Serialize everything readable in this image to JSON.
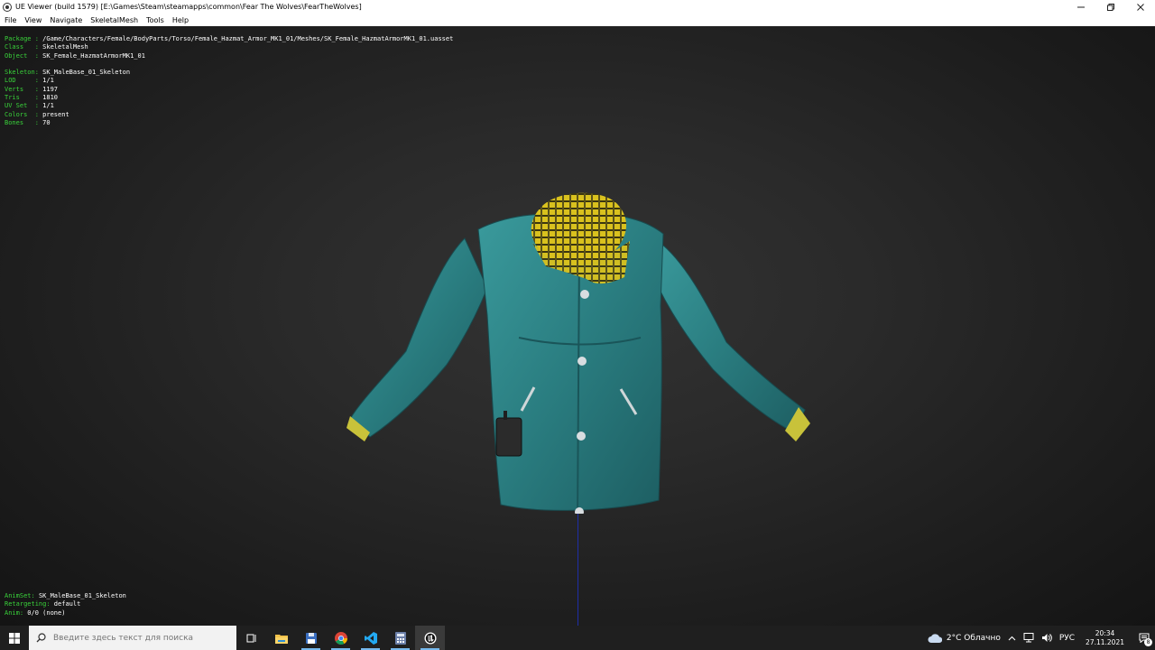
{
  "window": {
    "title": "UE Viewer (build 1579) [E:\\Games\\Steam\\steamapps\\common\\Fear The Wolves\\FearTheWolves]",
    "controls": [
      "minimize-icon",
      "restore-icon",
      "close-icon"
    ]
  },
  "menu": [
    "File",
    "View",
    "Navigate",
    "SkeletalMesh",
    "Tools",
    "Help"
  ],
  "info_top": [
    {
      "key": "Package : ",
      "value": "/Game/Characters/Female/BodyParts/Torso/Female_Hazmat_Armor_MK1_01/Meshes/SK_Female_HazmatArmorMK1_01.uasset"
    },
    {
      "key": "Class   : ",
      "value": "SkeletalMesh"
    },
    {
      "key": "Object  : ",
      "value": "SK_Female_HazmatArmorMK1_01"
    },
    {
      "key": "",
      "value": ""
    },
    {
      "key": "Skeleton: ",
      "value": "SK_MaleBase_01_Skeleton"
    },
    {
      "key": "LOD     : ",
      "value": "1/1"
    },
    {
      "key": "Verts   : ",
      "value": "1197"
    },
    {
      "key": "Tris    : ",
      "value": "1810"
    },
    {
      "key": "UV Set  : ",
      "value": "1/1"
    },
    {
      "key": "Colors  : ",
      "value": "present"
    },
    {
      "key": "Bones   : ",
      "value": "70"
    }
  ],
  "info_bottom": [
    {
      "key": "AnimSet: ",
      "value": "SK_MaleBase_01_Skeleton"
    },
    {
      "key": "Retargeting: ",
      "value": "default"
    },
    {
      "key": "Anim: ",
      "value": "0/0 (none)"
    }
  ],
  "colors": {
    "info_key": "#39d23a",
    "info_value": "#ffffff",
    "jacket": "#2a7d80",
    "scarf": "#d9c11e",
    "axis": "#1e2ea8",
    "taskbar": "#1f1f1f"
  },
  "taskbar": {
    "search_placeholder": "Введите здесь текст для поиска",
    "apps": [
      "task-view-icon",
      "file-explorer-icon",
      "save-disk-icon",
      "chrome-icon",
      "vscode-icon",
      "calculator-icon",
      "unreal-icon"
    ],
    "weather": "2°C Облачно",
    "language": "РУС",
    "time": "20:34",
    "date": "27.11.2021",
    "notifications": "8"
  }
}
